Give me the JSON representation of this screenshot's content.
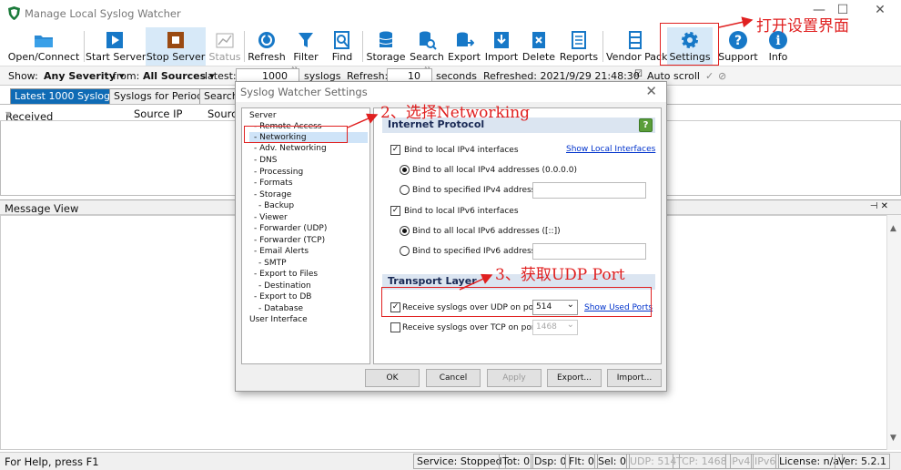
{
  "window": {
    "title": "Manage Local Syslog Watcher",
    "buttons": [
      "—",
      "☐",
      "✕"
    ]
  },
  "toolbar": {
    "buttons": [
      {
        "label": "Open/Connect",
        "icon": "folder-icon"
      },
      {
        "label": "Start Server",
        "icon": "play-icon"
      },
      {
        "label": "Stop Server",
        "icon": "stop-icon"
      },
      {
        "label": "Status",
        "icon": "chart-icon"
      },
      {
        "label": "Refresh",
        "icon": "refresh-icon"
      },
      {
        "label": "Filter",
        "icon": "filter-icon"
      },
      {
        "label": "Find",
        "icon": "find-icon"
      },
      {
        "label": "Storage",
        "icon": "database-icon"
      },
      {
        "label": "Search",
        "icon": "search-icon"
      },
      {
        "label": "Export",
        "icon": "export-icon"
      },
      {
        "label": "Import",
        "icon": "import-icon"
      },
      {
        "label": "Delete",
        "icon": "delete-icon"
      },
      {
        "label": "Reports",
        "icon": "reports-icon"
      },
      {
        "label": "Vendor Pack",
        "icon": "vendor-pack-icon"
      },
      {
        "label": "Settings",
        "icon": "gear-icon"
      },
      {
        "label": "Support",
        "icon": "help-icon"
      },
      {
        "label": "Info",
        "icon": "info-icon"
      }
    ]
  },
  "options": {
    "show_label": "Show:",
    "severity": "Any Severity",
    "from_label": "from:",
    "sources": "All Sources",
    "latest_label": "latest:",
    "latest_value": "1000",
    "syslogs_label": "syslogs",
    "refresh_label": "Refresh:",
    "refresh_value": "10",
    "seconds_label": "seconds",
    "refreshed": "Refreshed: 2021/9/29 21:48:30",
    "autoscroll": "Auto scroll"
  },
  "tabs": [
    "Latest 1000 Syslogs",
    "Syslogs for Period",
    "Search"
  ],
  "grid": {
    "columns": [
      "Received",
      "Source IP",
      "Sourc"
    ]
  },
  "message_view": {
    "title": "Message View",
    "pin": "⊣ ✕"
  },
  "status": {
    "help": "For Help, press F1",
    "panels": [
      "Service: Stopped",
      "Tot: 0",
      "Dsp: 0",
      "Flt: 0",
      "Sel: 0",
      "UDP: 514",
      "TCP: 1468",
      "IPv4",
      "IPv6",
      "License: n/a",
      "Ver: 5.2.1"
    ]
  },
  "dialog": {
    "title": "Syslog Watcher Settings",
    "tree": [
      "Server",
      "- Remote Access",
      "- Networking",
      "- Adv. Networking",
      "- DNS",
      "- Processing",
      "- Formats",
      "- Storage",
      "- Backup",
      "- Viewer",
      "- Forwarder (UDP)",
      "- Forwarder (TCP)",
      "- Email Alerts",
      "- SMTP",
      "- Export to Files",
      "- Destination",
      "- Export to DB",
      "- Database",
      "User Interface"
    ],
    "internet_protocol": "Internet Protocol",
    "bind_ipv4": "Bind to local IPv4 interfaces",
    "show_local_interfaces": "Show Local Interfaces",
    "bind_all_ipv4": "Bind to all local IPv4 addresses (0.0.0.0)",
    "bind_spec_ipv4": "Bind to specified IPv4 address:",
    "bind_ipv6": "Bind to local IPv6 interfaces",
    "bind_all_ipv6": "Bind to all local IPv6 addresses ([::])",
    "bind_spec_ipv6": "Bind to specified IPv6 address:",
    "transport_layer": "Transport Layer",
    "udp_label": "Receive syslogs over UDP on port:",
    "udp_port": "514",
    "show_used_ports": "Show Used Ports",
    "tcp_label": "Receive syslogs over TCP on port:",
    "tcp_port": "1468",
    "buttons": [
      "OK",
      "Cancel",
      "Apply",
      "Export...",
      "Import..."
    ],
    "help_symbol": "?"
  },
  "annotations": {
    "settings": "打开设置界面",
    "networking": "2、选择Networking",
    "udp": "3、获取UDP Port"
  },
  "colors": {
    "accent": "#0f6bb5",
    "annotation": "#e02020",
    "section": "#dbe5f1"
  }
}
